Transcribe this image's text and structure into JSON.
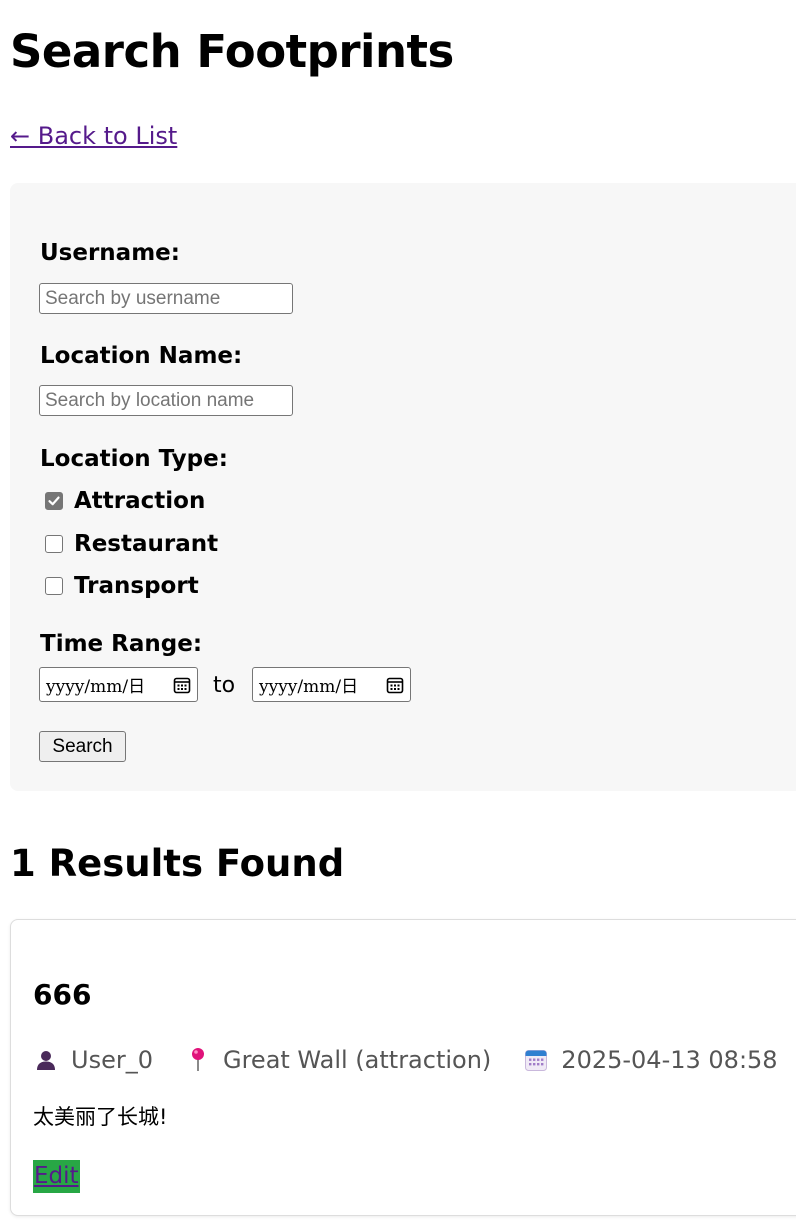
{
  "page": {
    "title": "Search Footprints",
    "back_link": "← Back to List"
  },
  "search": {
    "username_label": "Username:",
    "username_placeholder": "Search by username",
    "username_value": "",
    "location_name_label": "Location Name:",
    "location_name_placeholder": "Search by location name",
    "location_name_value": "",
    "location_type_label": "Location Type:",
    "location_types": [
      {
        "label": "Attraction",
        "checked": true
      },
      {
        "label": "Restaurant",
        "checked": false
      },
      {
        "label": "Transport",
        "checked": false
      }
    ],
    "time_range_label": "Time Range:",
    "date_from_placeholder": "yyyy/mm/日",
    "date_to_placeholder": "yyyy/mm/日",
    "to_text": "to",
    "search_button": "Search"
  },
  "results": {
    "heading": "1 Results Found",
    "items": [
      {
        "title": "666",
        "user": "User_0",
        "location": "Great Wall (attraction)",
        "datetime": "2025-04-13 08:58",
        "description": "太美丽了长城!",
        "edit_label": "Edit"
      }
    ]
  },
  "icons": {
    "user": "user-icon",
    "location": "pushpin-icon",
    "date": "calendar-icon",
    "date_picker": "calendar-picker-icon"
  },
  "colors": {
    "link": "#551a8b",
    "panel_bg": "#f7f7f7",
    "edit_bg": "#28a745",
    "meta_text": "#555555",
    "checkbox_checked": "#767676"
  }
}
